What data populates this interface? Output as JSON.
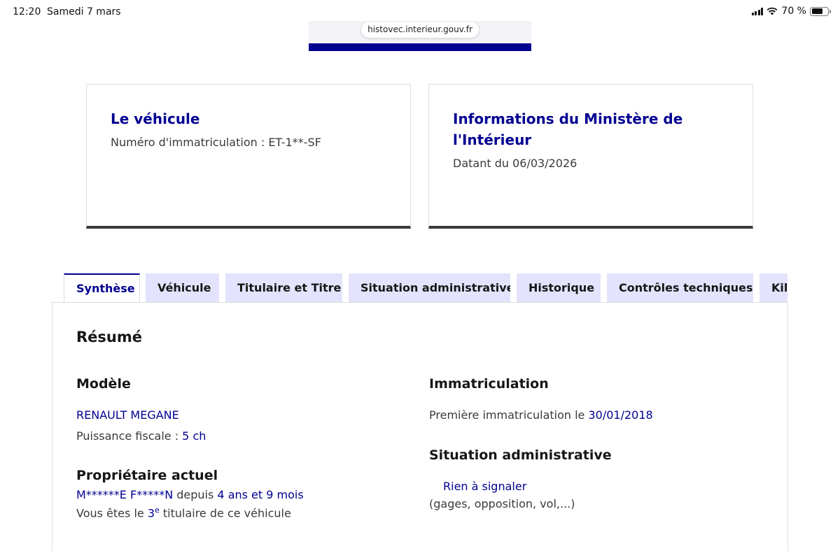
{
  "status_bar": {
    "time": "12:20",
    "date": "Samedi 7 mars",
    "battery": "70 %",
    "battery_level": 0.7
  },
  "browser": {
    "url": "histovec.interieur.gouv.fr"
  },
  "colors": {
    "accent": "#000091",
    "tab_bg": "#e3e3fd",
    "text": "#3a3a3a"
  },
  "cards": {
    "vehicle": {
      "title": "Le véhicule",
      "line": "Numéro d'immatriculation : ET-1**-SF"
    },
    "ministry": {
      "title": "Informations du Ministère de l'Intérieur",
      "line": "Datant du 06/03/2026"
    }
  },
  "tabs": [
    {
      "label": "Synthèse",
      "active": true
    },
    {
      "label": "Véhicule",
      "active": false
    },
    {
      "label": "Titulaire et Titre",
      "active": false
    },
    {
      "label": "Situation administrative",
      "active": false
    },
    {
      "label": "Historique",
      "active": false
    },
    {
      "label": "Contrôles techniques",
      "active": false
    },
    {
      "label": "Kilo",
      "active": false
    }
  ],
  "summary": {
    "title": "Résumé",
    "model": {
      "heading": "Modèle",
      "name": "RENAULT MEGANE",
      "power_label": "Puissance fiscale : ",
      "power_value": "5 ch"
    },
    "owner": {
      "heading": "Propriétaire actuel",
      "name": "M******E F*****N",
      "since_label": " depuis ",
      "since_value": "4 ans et 9 mois",
      "rank_prefix": "Vous êtes le ",
      "rank_number": "3",
      "rank_sup": "e",
      "rank_suffix": " titulaire de ce véhicule"
    },
    "registration": {
      "heading": "Immatriculation",
      "label": "Première immatriculation le ",
      "date": "30/01/2018"
    },
    "admin": {
      "heading": "Situation administrative",
      "status": "Rien à signaler",
      "detail": "(gages, opposition, vol,...)"
    }
  }
}
